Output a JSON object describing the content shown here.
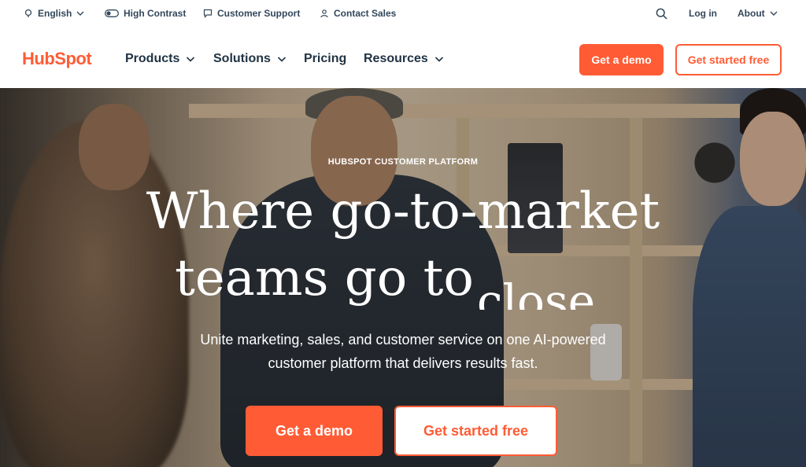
{
  "utility": {
    "language": "English",
    "high_contrast": "High Contrast",
    "support": "Customer Support",
    "sales": "Contact Sales",
    "login": "Log in",
    "about": "About"
  },
  "nav": {
    "logo": "HubSpot",
    "items": [
      {
        "label": "Products"
      },
      {
        "label": "Solutions"
      },
      {
        "label": "Pricing"
      },
      {
        "label": "Resources"
      }
    ],
    "demo_button": "Get a demo",
    "free_button": "Get started free"
  },
  "hero": {
    "eyebrow": "HUBSPOT CUSTOMER PLATFORM",
    "headline_line1": "Where go-to-market",
    "headline_line2": "teams go to",
    "headline_word": "close",
    "sub_line1": "Unite marketing, sales, and customer service on one AI-powered",
    "sub_line2": "customer platform that delivers results fast.",
    "demo_button": "Get a demo",
    "free_button": "Get started free"
  },
  "colors": {
    "brand_orange": "#ff5c35",
    "text_dark": "#213343"
  }
}
